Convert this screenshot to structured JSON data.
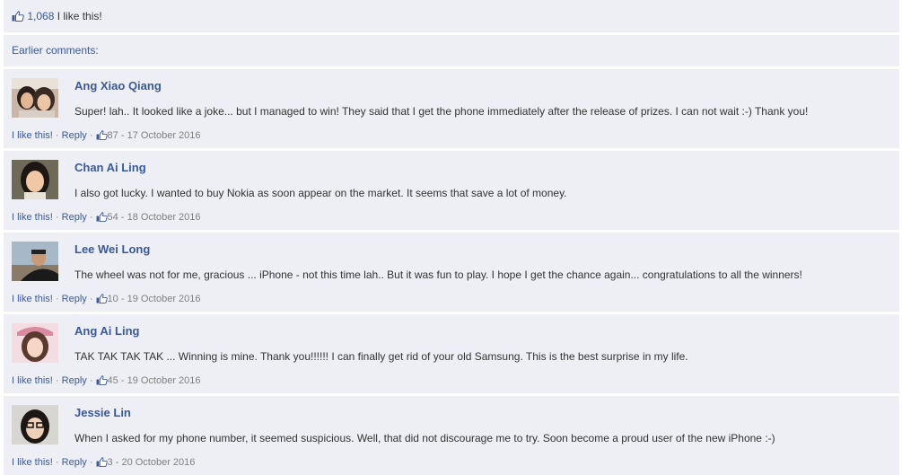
{
  "likes": {
    "count": "1,068",
    "text": "I like this!"
  },
  "earlier_label": "Earlier comments:",
  "action_labels": {
    "like": "I like this!",
    "separator": " · ",
    "reply": "Reply",
    "dash": " - "
  },
  "colors": {
    "link": "#3b5998",
    "panel": "#edeff4"
  },
  "comments": [
    {
      "name": "Ang Xiao Qiang",
      "text": "Super! lah.. It looked like a joke... but I managed to win! They said that I get the phone immediately after the release of prizes. I can not wait :-) Thank you!",
      "likes": "87",
      "date": "17 October 2016"
    },
    {
      "name": "Chan Ai Ling",
      "text": "I also got lucky. I wanted to buy Nokia as soon appear on the market. It seems that save a lot of money.",
      "likes": "54",
      "date": "18 October 2016"
    },
    {
      "name": "Lee Wei Long",
      "text": "The wheel was not for me, gracious ... iPhone - not this time lah.. But it was fun to play. I hope I get the chance again... congratulations to all the winners!",
      "likes": "10",
      "date": "19 October 2016"
    },
    {
      "name": "Ang Ai Ling",
      "text": "TAK TAK TAK TAK ... Winning is mine. Thank you!!!!!! I can finally get rid of your old Samsung. This is the best surprise in my life.",
      "likes": "45",
      "date": "19 October 2016"
    },
    {
      "name": "Jessie Lin",
      "text": "When I asked for my phone number, it seemed suspicious. Well, that did not discourage me to try. Soon become a proud user of the new iPhone :-)",
      "likes": "3",
      "date": "20 October 2016"
    }
  ]
}
